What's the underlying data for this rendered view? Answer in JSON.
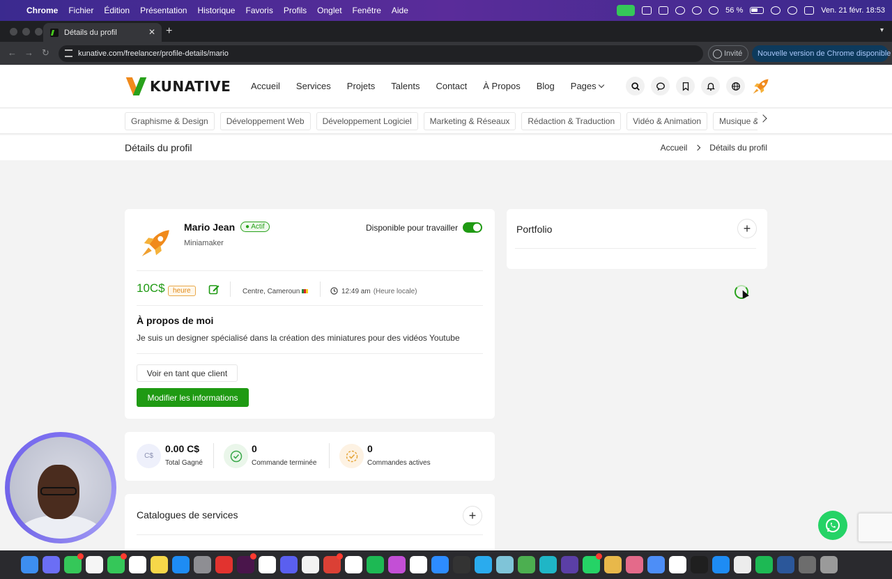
{
  "menubar": {
    "app": "Chrome",
    "items": [
      "Fichier",
      "Édition",
      "Présentation",
      "Historique",
      "Favoris",
      "Profils",
      "Onglet",
      "Fenêtre",
      "Aide"
    ],
    "battery": "56 %",
    "datetime": "Ven. 21 févr. 18:53"
  },
  "browser": {
    "tab_title": "Détails du profil",
    "url": "kunative.com/freelancer/profile-details/mario",
    "guest_label": "Invité",
    "update_label": "Nouvelle version de Chrome disponible"
  },
  "site": {
    "logo_text": "KUNATIVE",
    "nav": [
      "Accueil",
      "Services",
      "Projets",
      "Talents",
      "Contact",
      "À Propos",
      "Blog",
      "Pages"
    ],
    "categories": [
      "Graphisme & Design",
      "Développement Web",
      "Développement Logiciel",
      "Marketing & Réseaux",
      "Rédaction & Traduction",
      "Vidéo & Animation",
      "Musique & Aud"
    ]
  },
  "breadcrumb": {
    "page_title": "Détails du profil",
    "home": "Accueil",
    "current": "Détails du profil"
  },
  "profile": {
    "name": "Mario Jean",
    "status": "● Actif",
    "role": "Miniamaker",
    "availability_label": "Disponible pour travailler",
    "rate": "10C$",
    "rate_unit": "heure",
    "location": "Centre, Cameroun",
    "time": "12:49 am",
    "time_note": "(Heure locale)",
    "about_title": "À propos de moi",
    "about_text": "Je suis un designer spécialisé dans la création des miniatures pour des vidéos Youtube",
    "view_client_button": "Voir en tant que client",
    "edit_button": "Modifier les informations"
  },
  "stats": [
    {
      "icon_text": "C$",
      "value": "0.00 C$",
      "label": "Total Gagné"
    },
    {
      "icon_text": "",
      "value": "0",
      "label": "Commande terminée"
    },
    {
      "icon_text": "",
      "value": "0",
      "label": "Commandes actives"
    }
  ],
  "catalog": {
    "title": "Catalogues de services",
    "add": "+"
  },
  "portfolio": {
    "title": "Portfolio",
    "add": "+"
  },
  "colors": {
    "brand_green": "#1f9a13",
    "brand_orange": "#f08a1c"
  }
}
